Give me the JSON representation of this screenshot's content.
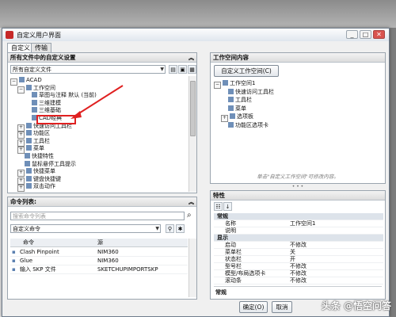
{
  "window": {
    "title": "自定义用户界面"
  },
  "tabs": [
    {
      "label": "自定义"
    },
    {
      "label": "传输"
    }
  ],
  "customizations_panel": {
    "header": "所有文件中的自定义设置",
    "file_dropdown": "所有自定义文件",
    "tree": [
      {
        "label": "ACAD",
        "level": 0,
        "expander": "−"
      },
      {
        "label": "工作空间",
        "level": 1,
        "expander": "−"
      },
      {
        "label": "草图与注释 默认 (当前)",
        "level": 2,
        "expander": ""
      },
      {
        "label": "三维建模",
        "level": 2,
        "expander": ""
      },
      {
        "label": "三维基础",
        "level": 2,
        "expander": ""
      },
      {
        "label": "CAD经典",
        "level": 2,
        "expander": ""
      },
      {
        "label": "快速访问工具栏",
        "level": 1,
        "expander": "+"
      },
      {
        "label": "功能区",
        "level": 1,
        "expander": "+"
      },
      {
        "label": "工具栏",
        "level": 1,
        "expander": "+"
      },
      {
        "label": "菜单",
        "level": 1,
        "expander": "+"
      },
      {
        "label": "快捷特性",
        "level": 1,
        "expander": ""
      },
      {
        "label": "鼠标悬停工具提示",
        "level": 1,
        "expander": ""
      },
      {
        "label": "快捷菜单",
        "level": 1,
        "expander": "+"
      },
      {
        "label": "键盘快捷键",
        "level": 1,
        "expander": "+"
      },
      {
        "label": "双击动作",
        "level": 1,
        "expander": "+"
      }
    ]
  },
  "command_panel": {
    "header": "命令列表:",
    "search_placeholder": "搜索命令列表",
    "filter_dropdown": "自定义命令",
    "columns": [
      "命令",
      "源"
    ],
    "rows": [
      {
        "command": "Clash Pinpoint",
        "source": "NIM360"
      },
      {
        "command": "Glue",
        "source": "NIM360"
      },
      {
        "command": "输入 SKP 文件",
        "source": "SKETCHUPIMPORTSKP"
      }
    ]
  },
  "workspace_panel": {
    "header": "工作空间内容",
    "customize_button": "自定义工作空间(C)",
    "tree": [
      {
        "label": "工作空间1",
        "level": 0,
        "expander": "−"
      },
      {
        "label": "快速访问工具栏",
        "level": 1,
        "expander": ""
      },
      {
        "label": "工具栏",
        "level": 1,
        "expander": ""
      },
      {
        "label": "菜单",
        "level": 1,
        "expander": ""
      },
      {
        "label": "选项板",
        "level": 1,
        "expander": "+"
      },
      {
        "label": "功能区选项卡",
        "level": 1,
        "expander": ""
      }
    ],
    "hint": "单击\"自定义工作空间\"可修改内容。"
  },
  "properties_panel": {
    "header": "特性",
    "rows": [
      {
        "type": "category",
        "label": "常规"
      },
      {
        "type": "prop",
        "label": "名称",
        "value": "工作空间1"
      },
      {
        "type": "prop",
        "label": "说明",
        "value": ""
      },
      {
        "type": "category",
        "label": "显示"
      },
      {
        "type": "prop",
        "label": "启动",
        "value": "不修改"
      },
      {
        "type": "prop",
        "label": "菜单栏",
        "value": "关"
      },
      {
        "type": "prop",
        "label": "状态栏",
        "value": "开"
      },
      {
        "type": "prop",
        "label": "型号栏",
        "value": "不修改"
      },
      {
        "type": "prop",
        "label": "模型/布局选项卡",
        "value": "不修改"
      },
      {
        "type": "prop",
        "label": "滚动条",
        "value": "不修改"
      }
    ],
    "description_title": "常规"
  },
  "footer": {
    "ok_button": "确定(O)",
    "cancel_button": "取消"
  },
  "watermark": "头条 @悟空问答",
  "colors": {
    "highlight_box": "#e02020",
    "category_bg": "#dde3ea"
  }
}
